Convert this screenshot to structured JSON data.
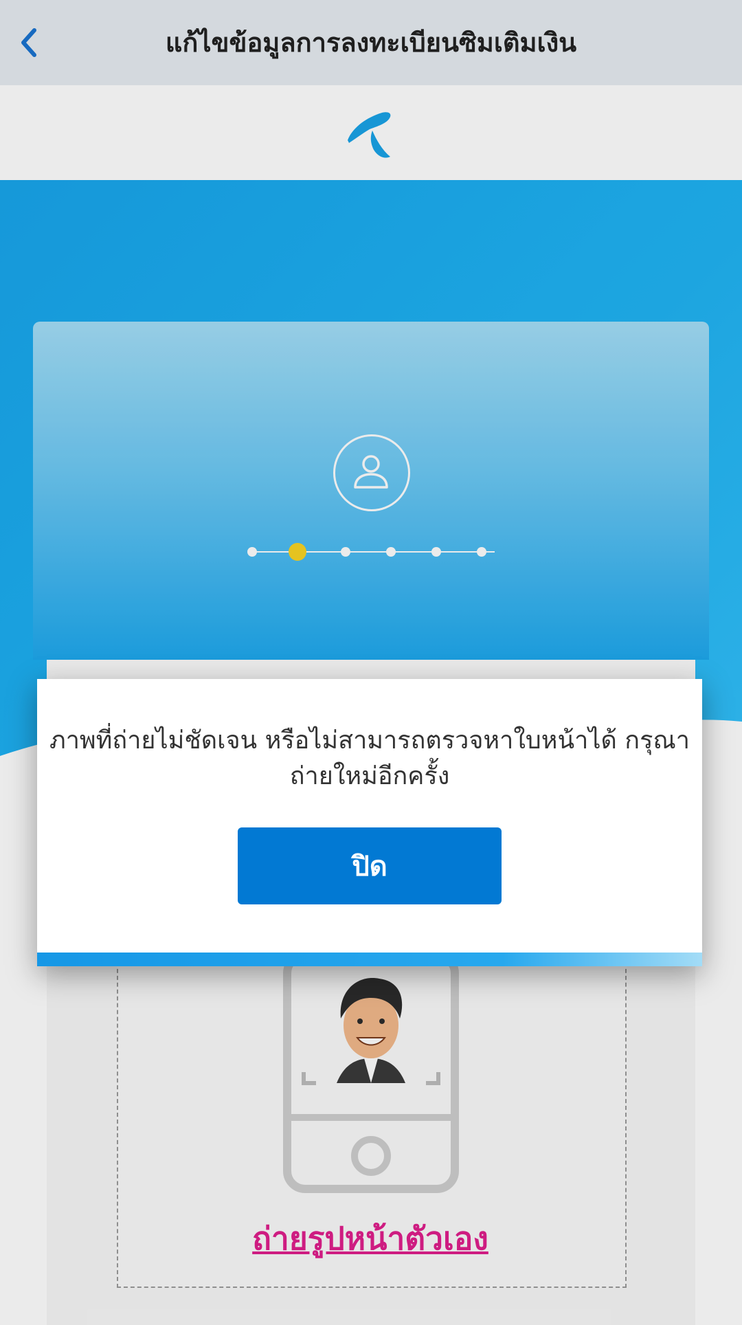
{
  "header": {
    "title": "แก้ไขข้อมูลการลงทะเบียนซิมเติมเงิน",
    "back_icon": "chevron-left-icon"
  },
  "brand": {
    "logo_icon": "dtac-logo-icon",
    "color": "#19a3e8"
  },
  "progress": {
    "total_steps": 6,
    "current_step": 2,
    "active_color": "#f9d423"
  },
  "card": {
    "icon": "user-icon"
  },
  "dialog": {
    "message": "ภาพที่ถ่ายไม่ชัดเจน หรือไม่สามารถตรวจหาใบหน้าได้ กรุณาถ่ายใหม่อีกครั้ง",
    "close_label": "ปิด",
    "button_color": "#0279d3"
  },
  "selfie": {
    "link_label": "ถ่ายรูปหน้าตัวเอง",
    "link_color": "#e01f8c"
  }
}
